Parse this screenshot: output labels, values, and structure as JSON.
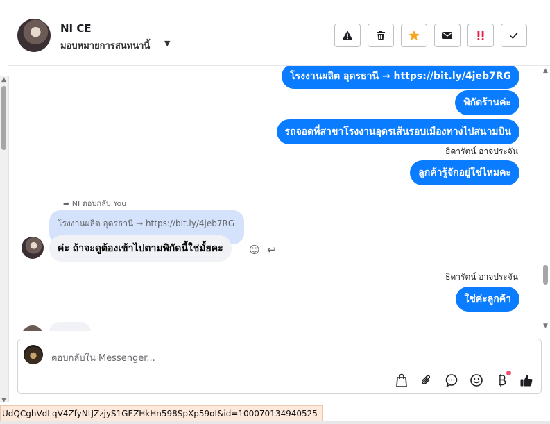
{
  "header": {
    "name": "NI CE",
    "assign_label": "มอบหมายการสนทนานี้",
    "tools": [
      {
        "icon": "warning-icon",
        "label": "Mark as spam"
      },
      {
        "icon": "trash-icon",
        "label": "Delete"
      },
      {
        "icon": "star-icon",
        "label": "Follow up"
      },
      {
        "icon": "envelope-icon",
        "label": "Mark as unread"
      },
      {
        "icon": "priority-icon",
        "label": "Priority"
      },
      {
        "icon": "check-icon",
        "label": "Mark as done"
      }
    ]
  },
  "messages": {
    "out1": "โรงงานผลิต อุดรธานี → ",
    "out1_link": "https://bit.ly/4jeb7RG",
    "out2": "พิกัดร้านค่ะ",
    "out3": "รถจอดที่สาขาโรงงานอุดรเส้นรอบเมืองทางไปสนามบิน",
    "sender1": "ธิดารัตน์ อาจประจัน",
    "out4": "ลูกค้ารู้จักอยู่ใช่ไหมคะ",
    "reply_tag": "NI ตอบกลับ You",
    "quoted": "โรงงานผลิต อุดรธานี → https://bit.ly/4jeb7RG",
    "in1": "ค่ะ ถ้าจะดูต้องเข้าไปตามพิกัดนี้ใช่มั้ยคะ",
    "sender2": "ธิดารัตน์ อาจประจัน",
    "out5": "ใช่ค่ะลูกค้า"
  },
  "composer": {
    "placeholder": "ตอบกลับใน Messenger...",
    "icons": [
      "bag-icon",
      "paperclip-icon",
      "saved-reply-icon",
      "emoji-icon",
      "currency-icon",
      "thumbs-up-icon"
    ]
  },
  "statusbar": {
    "url_fragment": "UdQCghVdLqV4ZfyNtJZzjyS1GEZHkHn598SpXp59oI&id=100070134940525"
  },
  "colors": {
    "accent": "#0a7cff",
    "incoming_bubble": "#f0f2f5",
    "quote_bubble": "#d4e3fb",
    "star": "#f5a623",
    "priority": "#e41e3f"
  }
}
